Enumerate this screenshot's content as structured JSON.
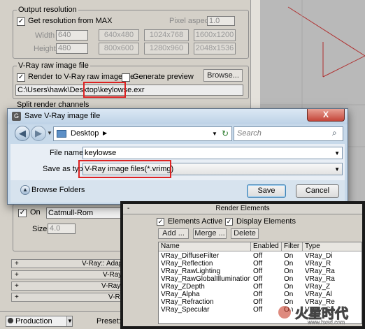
{
  "output_resolution": {
    "title": "Output resolution",
    "get_from_max_label": "Get resolution from MAX",
    "get_from_max_checked": true,
    "pixel_aspect_label": "Pixel aspect:",
    "pixel_aspect_value": "1.0",
    "width_label": "Width",
    "width_value": "640",
    "height_label": "Height",
    "height_value": "480",
    "presets": [
      "640x480",
      "1024x768",
      "1600x1200",
      "800x600",
      "1280x960",
      "2048x1536"
    ]
  },
  "raw_image_file": {
    "title": "V-Ray raw image file",
    "render_to_raw_label": "Render to V-Ray raw image file",
    "render_to_raw_checked": true,
    "generate_preview_label": "Generate preview",
    "generate_preview_checked": false,
    "browse_label": "Browse...",
    "path_prefix": "C:\\Users\\hawk\\Desktop\\",
    "path_file": "keylowse.exr"
  },
  "split_channels_title": "Split render channels",
  "lower_panel": {
    "on_label": "On",
    "filter_value": "Catmull-Rom",
    "size_label": "Size:",
    "size_value": "4.0"
  },
  "rollouts": [
    "V-Ray:: Adaptive",
    "V-Ray:",
    "V-Ray:",
    "V-Ray"
  ],
  "bottom_bar": {
    "mode_value": "Production",
    "preset_label": "Preset:"
  },
  "save_dialog": {
    "title": "Save V-Ray image file",
    "close_glyph": "X",
    "location": "Desktop",
    "search_placeholder": "Search",
    "file_name_label": "File name:",
    "file_name_value": "keylowse",
    "save_as_type_label": "Save as type:",
    "save_as_type_value": "V-Ray image files(*.vrimg)",
    "browse_folders_label": "Browse Folders",
    "save_label": "Save",
    "cancel_label": "Cancel"
  },
  "render_elements": {
    "title": "Render Elements",
    "collapse_glyph": "-",
    "elements_active_label": "Elements Active",
    "elements_active_checked": true,
    "display_elements_label": "Display Elements",
    "display_elements_checked": true,
    "add_label": "Add ...",
    "merge_label": "Merge ...",
    "delete_label": "Delete",
    "columns": [
      "Name",
      "Enabled",
      "Filter",
      "Type"
    ],
    "rows": [
      [
        "VRay_DiffuseFilter",
        "Off",
        "On",
        "VRay_Di"
      ],
      [
        "VRay_Reflection",
        "Off",
        "On",
        "VRay_R"
      ],
      [
        "VRay_RawLighting",
        "Off",
        "On",
        "VRay_Ra"
      ],
      [
        "VRay_RawGlobalIllumination",
        "Off",
        "On",
        "VRay_Ra"
      ],
      [
        "VRay_ZDepth",
        "Off",
        "On",
        "VRay_Z"
      ],
      [
        "VRay_Alpha",
        "Off",
        "On",
        "VRay_Al"
      ],
      [
        "VRay_Refraction",
        "Off",
        "On",
        "VRay_Re"
      ],
      [
        "VRay_Specular",
        "Off",
        "On",
        "VRay_Sp"
      ]
    ]
  },
  "watermark": {
    "text": "火星时代",
    "url": "www.hxsd.com"
  },
  "colors": {
    "panel_gray": "#d4d0c8",
    "dialog_blue": "#c7d9ea",
    "highlight_red": "#dd2222",
    "close_red": "#c4463a"
  }
}
